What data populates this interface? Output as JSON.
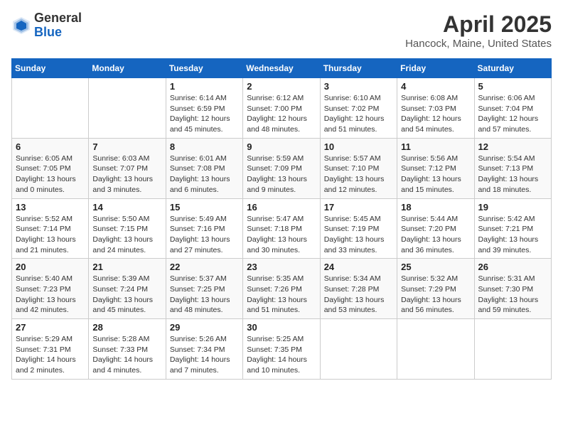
{
  "header": {
    "logo_general": "General",
    "logo_blue": "Blue",
    "month_title": "April 2025",
    "location": "Hancock, Maine, United States"
  },
  "columns": [
    "Sunday",
    "Monday",
    "Tuesday",
    "Wednesday",
    "Thursday",
    "Friday",
    "Saturday"
  ],
  "weeks": [
    [
      {
        "day": "",
        "sunrise": "",
        "sunset": "",
        "daylight": ""
      },
      {
        "day": "",
        "sunrise": "",
        "sunset": "",
        "daylight": ""
      },
      {
        "day": "1",
        "sunrise": "Sunrise: 6:14 AM",
        "sunset": "Sunset: 6:59 PM",
        "daylight": "Daylight: 12 hours and 45 minutes."
      },
      {
        "day": "2",
        "sunrise": "Sunrise: 6:12 AM",
        "sunset": "Sunset: 7:00 PM",
        "daylight": "Daylight: 12 hours and 48 minutes."
      },
      {
        "day": "3",
        "sunrise": "Sunrise: 6:10 AM",
        "sunset": "Sunset: 7:02 PM",
        "daylight": "Daylight: 12 hours and 51 minutes."
      },
      {
        "day": "4",
        "sunrise": "Sunrise: 6:08 AM",
        "sunset": "Sunset: 7:03 PM",
        "daylight": "Daylight: 12 hours and 54 minutes."
      },
      {
        "day": "5",
        "sunrise": "Sunrise: 6:06 AM",
        "sunset": "Sunset: 7:04 PM",
        "daylight": "Daylight: 12 hours and 57 minutes."
      }
    ],
    [
      {
        "day": "6",
        "sunrise": "Sunrise: 6:05 AM",
        "sunset": "Sunset: 7:05 PM",
        "daylight": "Daylight: 13 hours and 0 minutes."
      },
      {
        "day": "7",
        "sunrise": "Sunrise: 6:03 AM",
        "sunset": "Sunset: 7:07 PM",
        "daylight": "Daylight: 13 hours and 3 minutes."
      },
      {
        "day": "8",
        "sunrise": "Sunrise: 6:01 AM",
        "sunset": "Sunset: 7:08 PM",
        "daylight": "Daylight: 13 hours and 6 minutes."
      },
      {
        "day": "9",
        "sunrise": "Sunrise: 5:59 AM",
        "sunset": "Sunset: 7:09 PM",
        "daylight": "Daylight: 13 hours and 9 minutes."
      },
      {
        "day": "10",
        "sunrise": "Sunrise: 5:57 AM",
        "sunset": "Sunset: 7:10 PM",
        "daylight": "Daylight: 13 hours and 12 minutes."
      },
      {
        "day": "11",
        "sunrise": "Sunrise: 5:56 AM",
        "sunset": "Sunset: 7:12 PM",
        "daylight": "Daylight: 13 hours and 15 minutes."
      },
      {
        "day": "12",
        "sunrise": "Sunrise: 5:54 AM",
        "sunset": "Sunset: 7:13 PM",
        "daylight": "Daylight: 13 hours and 18 minutes."
      }
    ],
    [
      {
        "day": "13",
        "sunrise": "Sunrise: 5:52 AM",
        "sunset": "Sunset: 7:14 PM",
        "daylight": "Daylight: 13 hours and 21 minutes."
      },
      {
        "day": "14",
        "sunrise": "Sunrise: 5:50 AM",
        "sunset": "Sunset: 7:15 PM",
        "daylight": "Daylight: 13 hours and 24 minutes."
      },
      {
        "day": "15",
        "sunrise": "Sunrise: 5:49 AM",
        "sunset": "Sunset: 7:16 PM",
        "daylight": "Daylight: 13 hours and 27 minutes."
      },
      {
        "day": "16",
        "sunrise": "Sunrise: 5:47 AM",
        "sunset": "Sunset: 7:18 PM",
        "daylight": "Daylight: 13 hours and 30 minutes."
      },
      {
        "day": "17",
        "sunrise": "Sunrise: 5:45 AM",
        "sunset": "Sunset: 7:19 PM",
        "daylight": "Daylight: 13 hours and 33 minutes."
      },
      {
        "day": "18",
        "sunrise": "Sunrise: 5:44 AM",
        "sunset": "Sunset: 7:20 PM",
        "daylight": "Daylight: 13 hours and 36 minutes."
      },
      {
        "day": "19",
        "sunrise": "Sunrise: 5:42 AM",
        "sunset": "Sunset: 7:21 PM",
        "daylight": "Daylight: 13 hours and 39 minutes."
      }
    ],
    [
      {
        "day": "20",
        "sunrise": "Sunrise: 5:40 AM",
        "sunset": "Sunset: 7:23 PM",
        "daylight": "Daylight: 13 hours and 42 minutes."
      },
      {
        "day": "21",
        "sunrise": "Sunrise: 5:39 AM",
        "sunset": "Sunset: 7:24 PM",
        "daylight": "Daylight: 13 hours and 45 minutes."
      },
      {
        "day": "22",
        "sunrise": "Sunrise: 5:37 AM",
        "sunset": "Sunset: 7:25 PM",
        "daylight": "Daylight: 13 hours and 48 minutes."
      },
      {
        "day": "23",
        "sunrise": "Sunrise: 5:35 AM",
        "sunset": "Sunset: 7:26 PM",
        "daylight": "Daylight: 13 hours and 51 minutes."
      },
      {
        "day": "24",
        "sunrise": "Sunrise: 5:34 AM",
        "sunset": "Sunset: 7:28 PM",
        "daylight": "Daylight: 13 hours and 53 minutes."
      },
      {
        "day": "25",
        "sunrise": "Sunrise: 5:32 AM",
        "sunset": "Sunset: 7:29 PM",
        "daylight": "Daylight: 13 hours and 56 minutes."
      },
      {
        "day": "26",
        "sunrise": "Sunrise: 5:31 AM",
        "sunset": "Sunset: 7:30 PM",
        "daylight": "Daylight: 13 hours and 59 minutes."
      }
    ],
    [
      {
        "day": "27",
        "sunrise": "Sunrise: 5:29 AM",
        "sunset": "Sunset: 7:31 PM",
        "daylight": "Daylight: 14 hours and 2 minutes."
      },
      {
        "day": "28",
        "sunrise": "Sunrise: 5:28 AM",
        "sunset": "Sunset: 7:33 PM",
        "daylight": "Daylight: 14 hours and 4 minutes."
      },
      {
        "day": "29",
        "sunrise": "Sunrise: 5:26 AM",
        "sunset": "Sunset: 7:34 PM",
        "daylight": "Daylight: 14 hours and 7 minutes."
      },
      {
        "day": "30",
        "sunrise": "Sunrise: 5:25 AM",
        "sunset": "Sunset: 7:35 PM",
        "daylight": "Daylight: 14 hours and 10 minutes."
      },
      {
        "day": "",
        "sunrise": "",
        "sunset": "",
        "daylight": ""
      },
      {
        "day": "",
        "sunrise": "",
        "sunset": "",
        "daylight": ""
      },
      {
        "day": "",
        "sunrise": "",
        "sunset": "",
        "daylight": ""
      }
    ]
  ]
}
